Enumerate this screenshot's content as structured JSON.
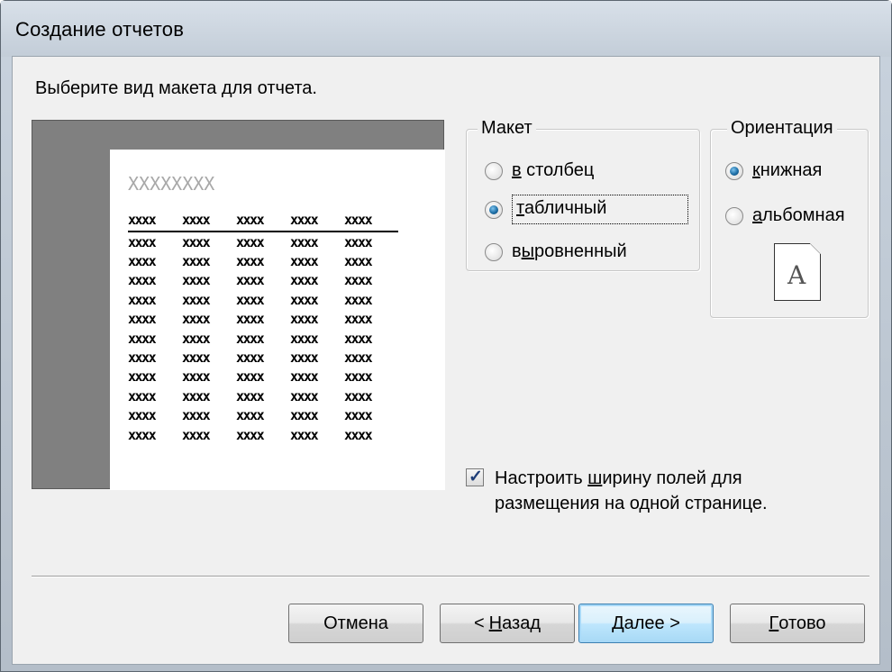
{
  "window": {
    "title": "Создание отчетов"
  },
  "prompt": "Выберите вид макета для отчета.",
  "preview": {
    "title_placeholder": "XXXXXXXX",
    "header_cells": [
      "xxxx",
      "xxxx",
      "xxxx",
      "xxxx",
      "xxxx"
    ],
    "row_cells": [
      "xxxx",
      "xxxx",
      "xxxx",
      "xxxx",
      "xxxx"
    ],
    "row_count": 11
  },
  "layout_group": {
    "legend": "Макет",
    "options": [
      {
        "label": "в столбец",
        "checked": false
      },
      {
        "label": "табличный",
        "checked": true
      },
      {
        "label": "выровненный",
        "checked": false
      }
    ]
  },
  "orientation_group": {
    "legend": "Ориентация",
    "options": [
      {
        "label": "книжная",
        "checked": true
      },
      {
        "label": "альбомная",
        "checked": false
      }
    ],
    "icon_letter": "A"
  },
  "fit_checkbox": {
    "checked": true,
    "label": "Настроить ширину полей для размещения на одной странице."
  },
  "buttons": {
    "cancel": "Отмена",
    "back": "< Назад",
    "next": "Далее >",
    "finish": "Готово"
  },
  "icons": {
    "check": "checkmark-icon",
    "page": "portrait-page-icon"
  },
  "colors": {
    "radio_selected": "#1d6ea6",
    "default_button": "#bee6fd",
    "preview_bg": "#808080"
  }
}
